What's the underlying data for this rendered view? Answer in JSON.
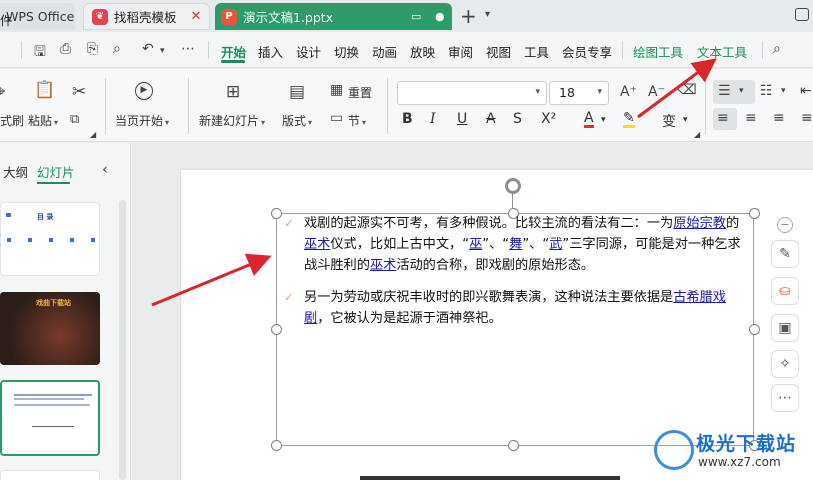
{
  "tabs": [
    {
      "label": "WPS Office"
    },
    {
      "label": "找稻壳模板",
      "close": "✕"
    },
    {
      "label": "演示文稿1.pptx",
      "badge": "P"
    }
  ],
  "menu": {
    "file_label": "件",
    "items": [
      "开始",
      "插入",
      "设计",
      "切换",
      "动画",
      "放映",
      "审阅",
      "视图",
      "工具",
      "会员专享",
      "绘图工具",
      "文本工具"
    ],
    "active": "开始"
  },
  "ribbon": {
    "format_painter": "式刷",
    "paste": "粘贴",
    "from_start": "当页开始",
    "new_slide": "新建幻灯片",
    "layout": "版式",
    "reset": "重置",
    "section": "节",
    "font_name": "",
    "font_size": "18"
  },
  "panel": {
    "outline_tab": "大纲",
    "slides_tab": "幻灯片",
    "thumb1_title": "目      录",
    "thumb2_title": "戏曲下载站"
  },
  "slide": {
    "para1_parts": [
      {
        "t": "戏剧的起源实不可考，有多种假说。比较主流的看法有二：一为",
        "link": false
      },
      {
        "t": "原始宗教",
        "link": true
      },
      {
        "t": "的",
        "link": false
      },
      {
        "t": "巫术",
        "link": true
      },
      {
        "t": "仪式，比如上古中文，“",
        "link": false
      },
      {
        "t": "巫",
        "link": true
      },
      {
        "t": "”、“",
        "link": false
      },
      {
        "t": "舞",
        "link": true
      },
      {
        "t": "”、“",
        "link": false
      },
      {
        "t": "武",
        "link": true
      },
      {
        "t": "”三字同源，可能是对一种乞求战斗胜利的",
        "link": false
      },
      {
        "t": "巫术",
        "link": true
      },
      {
        "t": "活动的合称，即戏剧的原始形态。",
        "link": false
      }
    ],
    "para2_parts": [
      {
        "t": "另一为劳动或庆祝丰收时的即兴歌舞表演，这种说法主要依据是",
        "link": false
      },
      {
        "t": "古希腊戏剧",
        "link": true
      },
      {
        "t": "，它被认为是起源于酒神祭祀。",
        "link": false
      }
    ]
  },
  "watermark": {
    "title": "极光下载站",
    "url": "www.xz7.com"
  }
}
